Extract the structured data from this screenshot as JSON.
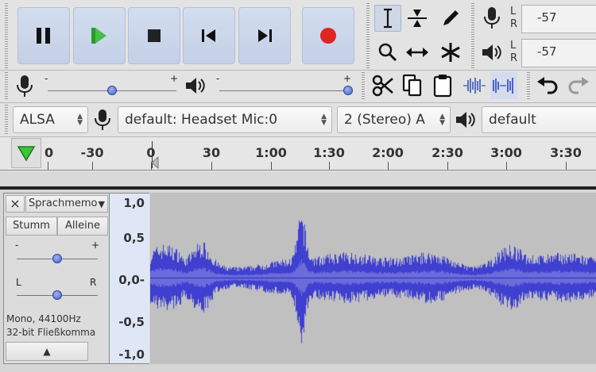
{
  "transport": {
    "pause": "pause-icon",
    "play": "play-icon",
    "stop": "stop-icon",
    "skip_start": "skip-to-start-icon",
    "skip_end": "skip-to-end-icon",
    "record": "record-icon",
    "record_color": "#e02424",
    "play_color": "#3cb43c"
  },
  "meters": {
    "record": {
      "l": "L",
      "r": "R",
      "value": "-57"
    },
    "playback": {
      "l": "L",
      "r": "R",
      "value": "-57"
    }
  },
  "mixer": {
    "minus": "-",
    "plus": "+",
    "record_level": 0.5,
    "playback_level": 1.0
  },
  "devices": {
    "host": "ALSA",
    "input": "default: Headset Mic:0",
    "channels": "2 (Stereo) A",
    "output": "default"
  },
  "ruler": {
    "ticks": [
      {
        "label": "0",
        "partial": true
      },
      {
        "label": "-30"
      },
      {
        "label": "0"
      },
      {
        "label": "30"
      },
      {
        "label": "1:00"
      },
      {
        "label": "1:30"
      },
      {
        "label": "2:00"
      },
      {
        "label": "2:30"
      },
      {
        "label": "3:00"
      },
      {
        "label": "3:30"
      }
    ]
  },
  "track": {
    "name": "Sprachmemo",
    "close": "×",
    "mute": "Stumm",
    "solo": "Alleine",
    "gain_minus": "-",
    "gain_plus": "+",
    "pan_left": "L",
    "pan_right": "R",
    "info_line1": "Mono, 44100Hz",
    "info_line2": "32-bit Fließkomma",
    "collapse": "▲",
    "gain_level": 0.5,
    "pan_level": 0.5,
    "vruler": [
      "1,0",
      "0,5",
      "0,0-",
      "-0,5",
      "-1,0"
    ],
    "wave_color": "#3f3fd0",
    "wave_rms_color": "#6b6bdc",
    "bg_color": "#c0c0c0"
  }
}
